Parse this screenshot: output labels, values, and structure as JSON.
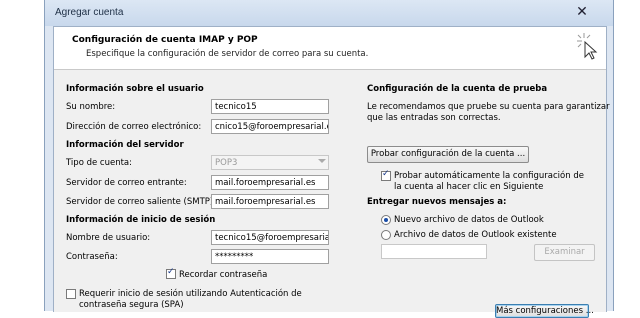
{
  "window": {
    "title": "Agregar cuenta",
    "close_glyph": "✕"
  },
  "header": {
    "title": "Configuración de cuenta IMAP y POP",
    "subtitle": "Especifique la configuración de servidor de correo para su cuenta.",
    "icon": "wizard-cursor-icon"
  },
  "user_info": {
    "heading": "Información sobre el usuario",
    "name_label": "Su nombre:",
    "name_value": "tecnico15",
    "email_label": "Dirección de correo electrónico:",
    "email_value": "cnico15@foroempresarial.es"
  },
  "server_info": {
    "heading": "Información del servidor",
    "account_type_label": "Tipo de cuenta:",
    "account_type_value": "POP3",
    "incoming_label": "Servidor de correo entrante:",
    "incoming_value": "mail.foroempresarial.es",
    "outgoing_label": "Servidor de correo saliente (SMTP):",
    "outgoing_value": "mail.foroempresarial.es"
  },
  "login_info": {
    "heading": "Información de inicio de sesión",
    "username_label": "Nombre de usuario:",
    "username_value": "tecnico15@foroempresarial.",
    "password_label": "Contraseña:",
    "password_value": "*********",
    "remember_label": "Recordar contraseña",
    "remember_checked": true,
    "spa_label_line1": "Requerir inicio de sesión utilizando Autenticación de",
    "spa_label_line2": "contraseña segura (SPA)",
    "spa_checked": false
  },
  "test_settings": {
    "heading": "Configuración de la cuenta de prueba",
    "desc_line1": "Le recomendamos que pruebe su cuenta para garantizar",
    "desc_line2": "que las entradas son correctas.",
    "test_button": "Probar configuración de la cuenta ...",
    "auto_test_line1": "Probar automáticamente la configuración de",
    "auto_test_line2": "la cuenta al hacer clic en Siguiente",
    "auto_test_checked": true
  },
  "delivery": {
    "heading": "Entregar nuevos mensajes a:",
    "option_new": "Nuevo archivo de datos de Outlook",
    "option_existing": "Archivo de datos de Outlook existente",
    "selected": "new",
    "browse_button": "Examinar"
  },
  "footer": {
    "more_settings_button": "Más configuraciones ..."
  }
}
